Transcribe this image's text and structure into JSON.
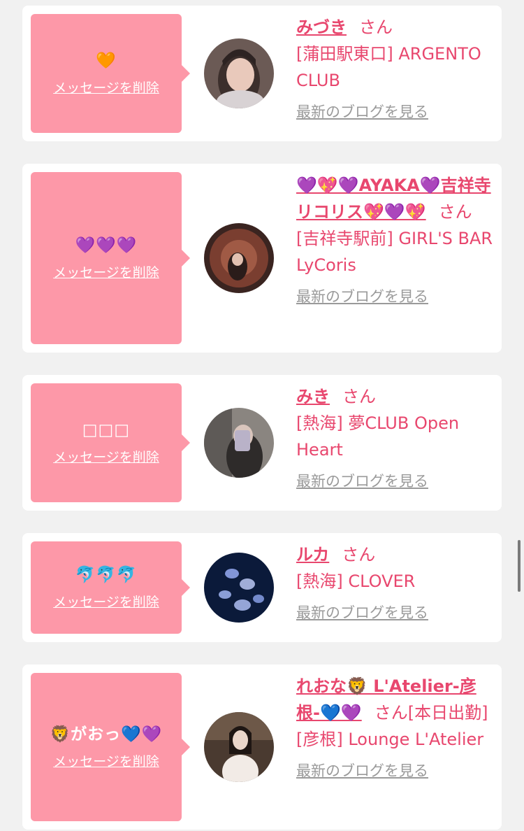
{
  "favorites": [
    {
      "message": "🧡",
      "delete_label": "メッセージを削除",
      "name": "みづき",
      "honorific": "さん",
      "shop": "[蒲田駅東口] ARGENTO CLUB",
      "blog_label": "最新のブログを見る"
    },
    {
      "message": "💜💜💜",
      "delete_label": "メッセージを削除",
      "name": "💜💖💜AYAKA💜吉祥寺リコリス💖💜💖",
      "honorific": "さん",
      "shop": "[吉祥寺駅前] GIRL'S BAR LyCoris",
      "blog_label": "最新のブログを見る"
    },
    {
      "message": "□□□",
      "delete_label": "メッセージを削除",
      "name": "みき",
      "honorific": "さん",
      "shop": "[熱海] 夢CLUB Open Heart",
      "blog_label": "最新のブログを見る"
    },
    {
      "message": "🐬🐬🐬",
      "delete_label": "メッセージを削除",
      "name": "ルカ",
      "honorific": "さん",
      "shop": "[熱海] CLOVER",
      "blog_label": "最新のブログを見る"
    },
    {
      "message": "🦁がおっ💙💜",
      "delete_label": "メッセージを削除",
      "name": "れおな🦁 L'Atelier-彦根-💙💜",
      "honorific": "さん[本日出勤]",
      "shop": "[彦根] Lounge L'Atelier",
      "blog_label": "最新のブログを見る"
    }
  ]
}
